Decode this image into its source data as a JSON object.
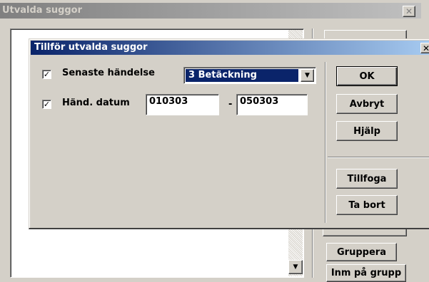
{
  "back_window": {
    "title": "Utvalda suggor",
    "close_glyph": "✕",
    "buttons": {
      "gruppera": "Gruppera",
      "inm_pa_grupp": "Inm på grupp"
    }
  },
  "dialog": {
    "title": "Tillför utvalda suggor",
    "close_glyph": "✕",
    "row1": {
      "checked": "✓",
      "label": "Senaste händelse",
      "select_value": "3 Betäckning"
    },
    "row2": {
      "checked": "✓",
      "label": "Händ. datum",
      "from_value": "010303",
      "separator": "-",
      "to_value": "050303"
    },
    "buttons": {
      "ok": "OK",
      "avbryt": "Avbryt",
      "hjalp": "Hjälp",
      "tillfoga": "Tillfoga",
      "ta_bort": "Ta bort"
    }
  },
  "colors": {
    "active_title": "#0a246a",
    "inactive_title": "#808080",
    "face": "#d4d0c8",
    "selection": "#0a246a"
  }
}
